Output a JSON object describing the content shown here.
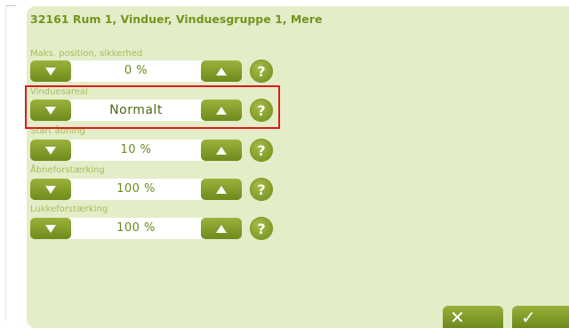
{
  "header": {
    "title": "32161 Rum 1, Vinduer, Vinduesgruppe 1, Mere"
  },
  "settings": [
    {
      "label": "Maks. position, sikkerhed",
      "value": "0 %",
      "help": "?"
    },
    {
      "label": "Vinduesareal",
      "value": "Normalt",
      "help": "?"
    },
    {
      "label": "Start åbning",
      "value": "10 %",
      "help": "?"
    },
    {
      "label": "Åbneforstærking",
      "value": "100 %",
      "help": "?"
    },
    {
      "label": "Lukkeforstærking",
      "value": "100 %",
      "help": "?"
    }
  ],
  "footer": {
    "cancel_symbol": "✕",
    "ok_symbol": "✓"
  },
  "colors": {
    "accent": "#76941e",
    "panel": "#e3edc8",
    "highlight": "#dd1a1a"
  },
  "icons": {
    "decrement": "triangle-down-icon",
    "increment": "triangle-up-icon",
    "help": "question-icon",
    "cancel": "close-icon",
    "ok": "checkmark-icon"
  }
}
